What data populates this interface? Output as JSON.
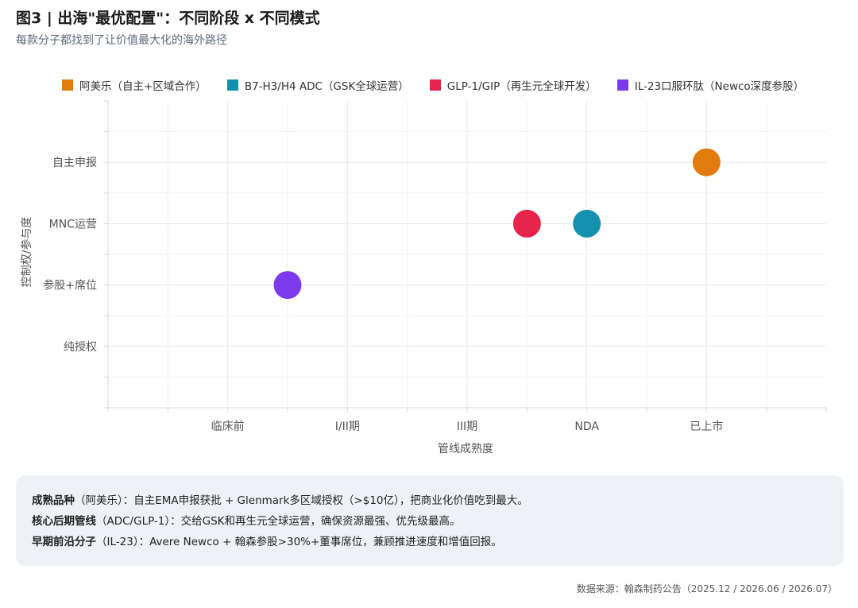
{
  "header": {
    "title": "图3 | 出海\"最优配置\"：不同阶段 x 不同模式",
    "subtitle": "每款分子都找到了让价值最大化的海外路径"
  },
  "chart_data": {
    "type": "scatter",
    "xlabel": "管线成熟度",
    "ylabel": "控制权/参与度",
    "x_categories": [
      "临床前",
      "I/II期",
      "III期",
      "NDA",
      "已上市"
    ],
    "y_categories": [
      "纯授权",
      "参股+席位",
      "MNC运营",
      "自主申报"
    ],
    "grid": true,
    "legend_position": "top",
    "series": [
      {
        "name": "阿美乐（自主+区域合作）",
        "color": "#e07b0c",
        "points": [
          {
            "x": "已上市",
            "y": "自主申报"
          }
        ]
      },
      {
        "name": "B7-H3/H4 ADC（GSK全球运营）",
        "color": "#1492ad",
        "points": [
          {
            "x": "NDA",
            "y": "MNC运营"
          }
        ]
      },
      {
        "name": "GLP-1/GIP（再生元全球开发）",
        "color": "#e5234b",
        "points": [
          {
            "x": "III期~NDA",
            "y": "MNC运营"
          }
        ]
      },
      {
        "name": "IL-23口服环肽（Newco深度参股）",
        "color": "#7c3aed",
        "points": [
          {
            "x": "临床前~I/II期",
            "y": "参股+席位"
          }
        ]
      }
    ]
  },
  "notes": [
    {
      "bold": "成熟品种",
      "text": "（阿美乐）：自主EMA申报获批 + Glenmark多区域授权（>$10亿），把商业化价值吃到最大。"
    },
    {
      "bold": "核心后期管线",
      "text": "（ADC/GLP-1）：交给GSK和再生元全球运营，确保资源最强、优先级最高。"
    },
    {
      "bold": "早期前沿分子",
      "text": "（IL-23）：Avere Newco + 翰森参股>30%+董事席位，兼顾推进速度和增值回报。"
    }
  ],
  "source": "数据来源：翰森制药公告（2025.12 / 2026.06 / 2026.07）"
}
